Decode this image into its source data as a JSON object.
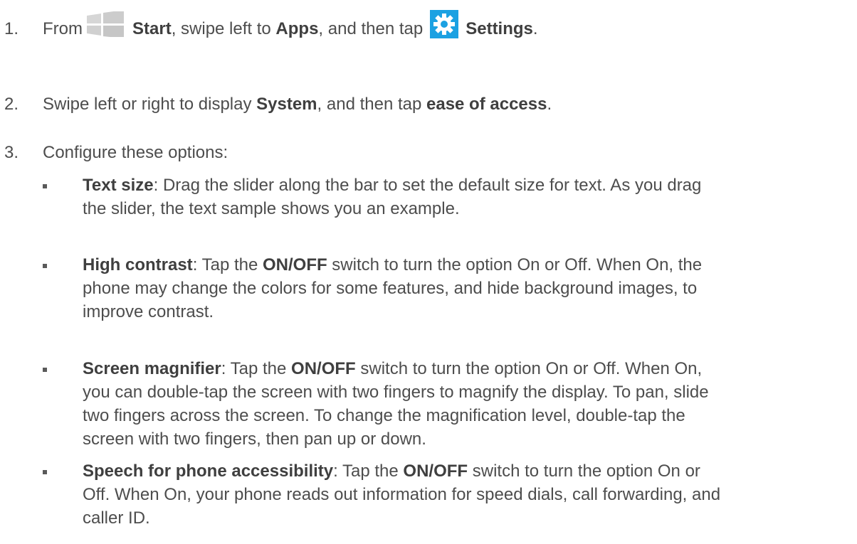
{
  "steps": [
    {
      "number": "1.",
      "parts": [
        "From",
        "Start",
        ", swipe left to ",
        "Apps",
        ", and then tap",
        "Settings",
        "."
      ],
      "icons": [
        "windows-start-icon",
        "settings-gear-icon"
      ]
    },
    {
      "number": "2.",
      "parts": [
        "Swipe left or right to display ",
        "System",
        ", and then tap ",
        "ease of access",
        "."
      ]
    },
    {
      "number": "3.",
      "text": "Configure these options:"
    }
  ],
  "options": [
    {
      "title": "Text size",
      "lines": [
        ": Drag the slider along the bar to set the default size for text. As you drag",
        "the slider, the text sample shows you an example."
      ]
    },
    {
      "title": "High contrast",
      "lines": [
        ": Tap the ",
        " switch to turn the option On or Off. When On, the",
        "phone may change the colors for some features, and hide background images, to",
        "improve contrast."
      ],
      "switch_label": "ON/OFF"
    },
    {
      "title": "Screen magnifier",
      "lines": [
        ": Tap the ",
        " switch to turn the option On or Off. When On,",
        "you can double-tap the screen with two fingers to magnify the display. To pan, slide",
        "two fingers across the screen. To change the magnification level, double-tap the",
        "screen with two fingers, then pan up or down."
      ],
      "switch_label": "ON/OFF"
    },
    {
      "title": "Speech for phone accessibility",
      "lines": [
        ": Tap the ",
        " switch to turn the option On or",
        "Off. When On, your phone reads out information for speed dials, call forwarding, and",
        "caller ID."
      ],
      "switch_label": "ON/OFF"
    }
  ],
  "colors": {
    "text": "#4d4d4d",
    "windows_tile": "#cfcfcf",
    "settings_tile": "#1ba1e2"
  }
}
